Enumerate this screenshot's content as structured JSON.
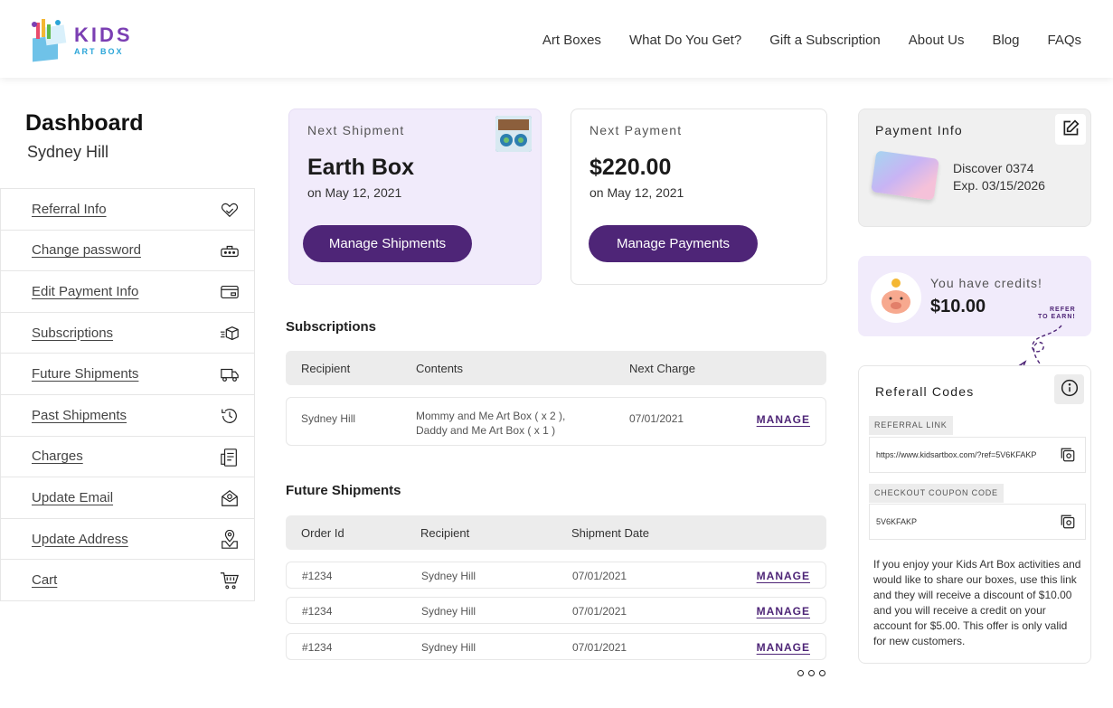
{
  "brand": {
    "logo_top": "KIDS",
    "logo_bottom": "ART BOX"
  },
  "nav": [
    "Art Boxes",
    "What Do You Get?",
    "Gift a Subscription",
    "About Us",
    "Blog",
    "FAQs"
  ],
  "dashboard": {
    "title": "Dashboard",
    "user": "Sydney Hill"
  },
  "sidebar": {
    "items": [
      {
        "label": "Referral Info",
        "icon": "handshake-heart-icon"
      },
      {
        "label": "Change password",
        "icon": "password-icon"
      },
      {
        "label": "Edit Payment Info",
        "icon": "credit-card-icon"
      },
      {
        "label": "Subscriptions",
        "icon": "box-delivery-icon"
      },
      {
        "label": "Future Shipments",
        "icon": "delivery-truck-icon"
      },
      {
        "label": "Past Shipments",
        "icon": "history-clock-icon"
      },
      {
        "label": "Charges",
        "icon": "receipt-icon"
      },
      {
        "label": "Update Email",
        "icon": "email-envelope-icon"
      },
      {
        "label": "Update Address",
        "icon": "map-pin-icon"
      },
      {
        "label": "Cart",
        "icon": "cart-icon"
      }
    ]
  },
  "next_shipment": {
    "label": "Next Shipment",
    "value": "Earth Box",
    "date": "on May 12, 2021",
    "button": "Manage Shipments"
  },
  "next_payment": {
    "label": "Next Payment",
    "value": "$220.00",
    "date": "on May 12, 2021",
    "button": "Manage Payments"
  },
  "subscriptions": {
    "title": "Subscriptions",
    "headers": [
      "Recipient",
      "Contents",
      "Next Charge"
    ],
    "rows": [
      {
        "recipient": "Sydney Hill",
        "contents_1": "Mommy and Me Art Box ( x 2 ),",
        "contents_2": "Daddy and Me Art Box ( x 1 )",
        "next_charge": "07/01/2021",
        "action": "MANAGE"
      }
    ]
  },
  "future_shipments": {
    "title": "Future Shipments",
    "headers": [
      "Order Id",
      "Recipient",
      "Shipment Date"
    ],
    "rows": [
      {
        "order_id": "#1234",
        "recipient": "Sydney Hill",
        "date": "07/01/2021",
        "action": "MANAGE"
      },
      {
        "order_id": "#1234",
        "recipient": "Sydney Hill",
        "date": "07/01/2021",
        "action": "MANAGE"
      },
      {
        "order_id": "#1234",
        "recipient": "Sydney Hill",
        "date": "07/01/2021",
        "action": "MANAGE"
      }
    ]
  },
  "payment_info": {
    "label": "Payment Info",
    "card": "Discover 0374",
    "exp": "Exp. 03/15/2026"
  },
  "credits": {
    "label": "You have credits!",
    "value": "$10.00",
    "refer_1": "REFER",
    "refer_2": "TO EARN!"
  },
  "referral": {
    "title": "Referall Codes",
    "link_label": "REFERRAL LINK",
    "link": "https://www.kidsartbox.com/?ref=5V6KFAKP",
    "coupon_label": "CHECKOUT COUPON CODE",
    "coupon": "5V6KFAKP",
    "description": "If you enjoy your Kids Art Box activities and would like to share our boxes, use this link and they will receive a discount of $10.00 and you will receive a credit on your account for $5.00. This offer is only valid for new customers."
  },
  "colors": {
    "brand_purple": "#4e2577",
    "lavender": "#f1ebfb",
    "accent_blue": "#2aa5d8"
  }
}
